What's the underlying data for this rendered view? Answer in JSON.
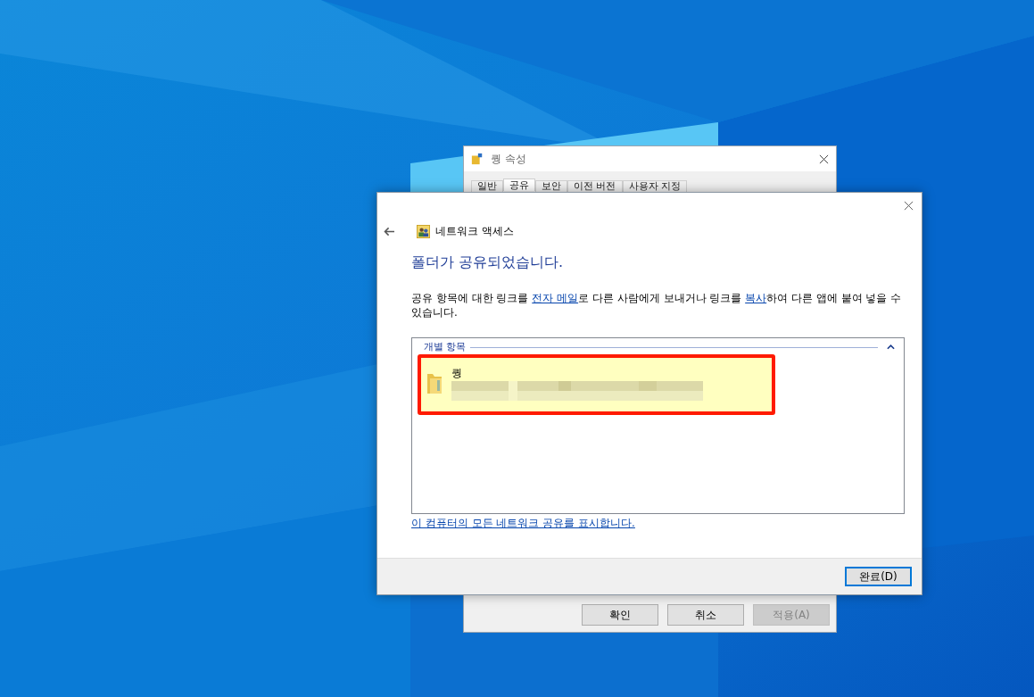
{
  "properties_window": {
    "title": "퀑 속성",
    "tabs": [
      {
        "label": "일반",
        "selected": false
      },
      {
        "label": "공유",
        "selected": true
      },
      {
        "label": "보안",
        "selected": false
      },
      {
        "label": "이전 버전",
        "selected": false
      },
      {
        "label": "사용자 지정",
        "selected": false
      }
    ],
    "buttons": [
      {
        "label": "확인",
        "disabled": false
      },
      {
        "label": "취소",
        "disabled": false
      },
      {
        "label": "적용(A)",
        "disabled": true
      }
    ]
  },
  "sharing_dialog": {
    "header": "네트워크 액세스",
    "heading": "폴더가 공유되었습니다.",
    "description": [
      {
        "text": "공유 항목에 대한 링크를 ",
        "link": false
      },
      {
        "text": "전자 메일",
        "link": true
      },
      {
        "text": "로 다른 사람에게 보내거나 링크를 ",
        "link": false
      },
      {
        "text": "복사",
        "link": true
      },
      {
        "text": "하여 다른 앱에 붙여 넣을 수 있습니다.",
        "link": false
      }
    ],
    "group": {
      "title": "개별 항목",
      "expanded": true,
      "items": [
        {
          "name": "퀑",
          "highlighted": true
        }
      ]
    },
    "show_all_link": "이 컴퓨터의 모든 네트워크 공유를 표시합니다.",
    "done_button": "완료(D)"
  }
}
